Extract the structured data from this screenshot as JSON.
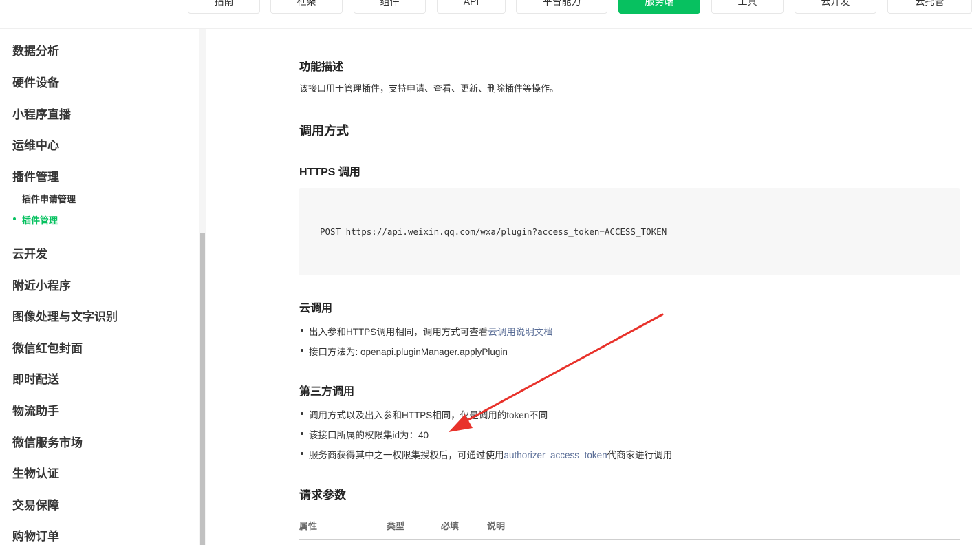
{
  "nav": {
    "items": [
      "指南",
      "框架",
      "组件",
      "API",
      "平台能力",
      "服务端",
      "工具",
      "云开发",
      "云托管"
    ],
    "active_index": 5
  },
  "sidebar": {
    "items": [
      "数据分析",
      "硬件设备",
      "小程序直播",
      "运维中心",
      "插件管理"
    ],
    "sub_items": [
      "插件申请管理",
      "插件管理"
    ],
    "items_after": [
      "云开发",
      "附近小程序",
      "图像处理与文字识别",
      "微信红包封面",
      "即时配送",
      "物流助手",
      "微信服务市场",
      "生物认证",
      "交易保障",
      "购物订单"
    ]
  },
  "content": {
    "partial_top": "",
    "func_title": "功能描述",
    "func_desc": "该接口用于管理插件，支持申请、查看、更新、删除插件等操作。",
    "call_title": "调用方式",
    "https_title": "HTTPS 调用",
    "code": "POST https://api.weixin.qq.com/wxa/plugin?access_token=ACCESS_TOKEN",
    "cloud_title": "云调用",
    "cloud_bullet1_text": "出入参和HTTPS调用相同，调用方式可查看",
    "cloud_bullet1_link": "云调用说明文档",
    "cloud_bullet2": "接口方法为: openapi.pluginManager.applyPlugin",
    "third_title": "第三方调用",
    "third_bullet1": "调用方式以及出入参和HTTPS相同，仅是调用的token不同",
    "third_bullet2": "该接口所属的权限集id为：40",
    "third_bullet3_pre": "服务商获得其中之一权限集授权后，可通过使用",
    "third_bullet3_link": "authorizer_access_token",
    "third_bullet3_post": "代商家进行调用",
    "params_title": "请求参数",
    "table_headers": [
      "属性",
      "类型",
      "必填",
      "说明"
    ]
  },
  "colors": {
    "accent": "#07c160",
    "link": "#576b95",
    "annotation_arrow": "#e8322b"
  }
}
